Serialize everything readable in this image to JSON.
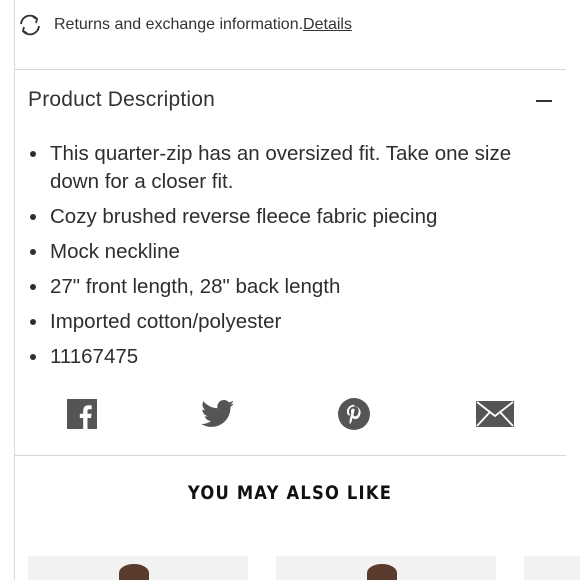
{
  "returns": {
    "icon": "refresh-arrows-icon",
    "text": "Returns and exchange information.",
    "link": "Details"
  },
  "description": {
    "title": "Product Description",
    "toggle_icon": "minus-icon",
    "bullets": [
      "This quarter-zip has an oversized fit. Take one size down for a closer fit.",
      "Cozy brushed reverse fleece fabric piecing",
      "Mock neckline",
      "27\" front length, 28\" back length",
      "Imported cotton/polyester",
      "11167475"
    ]
  },
  "share": {
    "icons": [
      "facebook-icon",
      "twitter-icon",
      "pinterest-icon",
      "email-icon"
    ],
    "color": "#555555"
  },
  "recommendations": {
    "title": "YOU MAY ALSO LIKE"
  }
}
